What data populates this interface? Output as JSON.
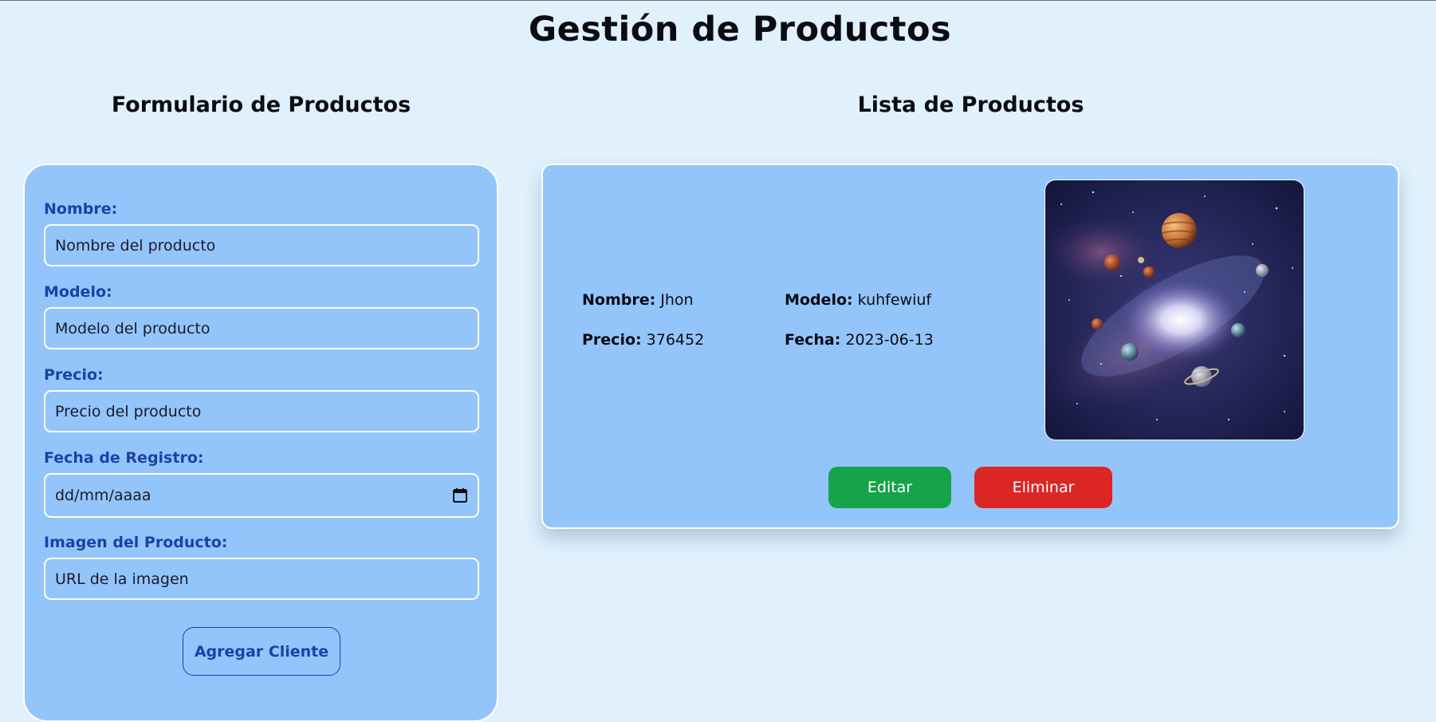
{
  "page": {
    "title": "Gestión de Productos"
  },
  "form": {
    "title": "Formulario de Productos",
    "fields": [
      {
        "label": "Nombre:",
        "placeholder": "Nombre del producto"
      },
      {
        "label": "Modelo:",
        "placeholder": "Modelo del producto"
      },
      {
        "label": "Precio:",
        "placeholder": "Precio del producto"
      },
      {
        "label": "Fecha de Registro:",
        "placeholder": "dd/mm/aaaa"
      },
      {
        "label": "Imagen del Producto:",
        "placeholder": "URL de la imagen"
      }
    ],
    "submit_label": "Agregar Cliente"
  },
  "list": {
    "title": "Lista de Productos",
    "products": [
      {
        "nombre_label": "Nombre:",
        "nombre": "Jhon",
        "modelo_label": "Modelo:",
        "modelo": "kuhfewiuf",
        "precio_label": "Precio:",
        "precio": "376452",
        "fecha_label": "Fecha:",
        "fecha": "2023-06-13",
        "edit_label": "Editar",
        "delete_label": "Eliminar"
      }
    ]
  },
  "colors": {
    "background": "#e0f1fd",
    "panel": "#93c5fb",
    "label_blue": "#1f3fa6",
    "edit_green": "#16a34a",
    "delete_red": "#dc2626"
  }
}
